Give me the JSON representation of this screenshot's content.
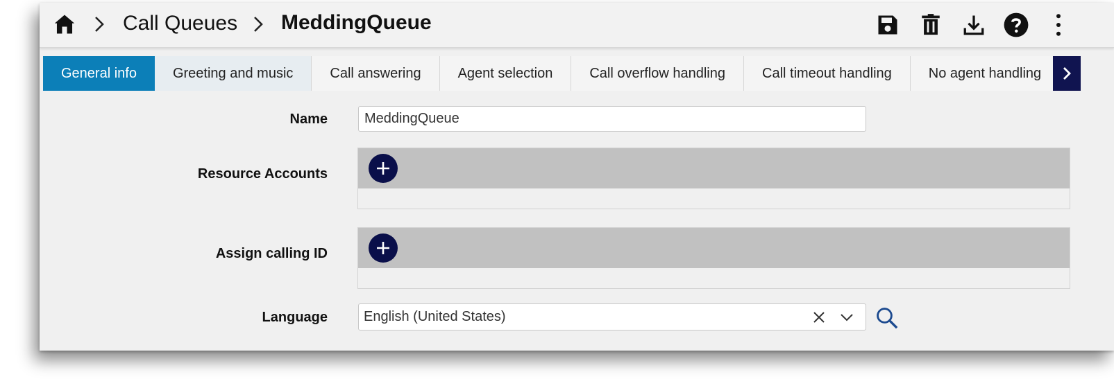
{
  "breadcrumb": {
    "home_icon": "home-icon",
    "separator_icon": "chevron-right-icon",
    "parent": "Call Queues",
    "current": "MeddingQueue"
  },
  "toolbar": {
    "icons": [
      "save-icon",
      "delete-icon",
      "download-icon",
      "help-icon",
      "more-vert-icon"
    ]
  },
  "tabs": [
    {
      "label": "General info",
      "active": true
    },
    {
      "label": "Greeting and music",
      "active": false
    },
    {
      "label": "Call answering",
      "active": false
    },
    {
      "label": "Agent selection",
      "active": false
    },
    {
      "label": "Call overflow handling",
      "active": false
    },
    {
      "label": "Call timeout handling",
      "active": false
    },
    {
      "label": "No agent handling",
      "active": false
    }
  ],
  "form": {
    "name": {
      "label": "Name",
      "value": "MeddingQueue"
    },
    "resource_accounts": {
      "label": "Resource Accounts"
    },
    "assign_calling_id": {
      "label": "Assign calling ID"
    },
    "language": {
      "label": "Language",
      "value": "English (United States)"
    }
  },
  "colors": {
    "active_tab": "#0c7fb8",
    "tab_arrow": "#101450",
    "add_button": "#0a0f4a",
    "panel_toolbar": "#c1c1c1"
  }
}
